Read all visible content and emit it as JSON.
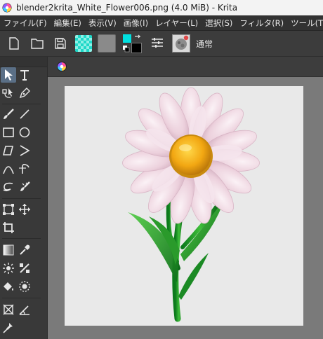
{
  "window": {
    "title": "blender2krita_White_Flower006.png (4.0 MiB)  - Krita"
  },
  "menu": [
    "ファイル(F)",
    "編集(E)",
    "表示(V)",
    "画像(I)",
    "レイヤー(L)",
    "選択(S)",
    "フィルタ(R)",
    "ツール(T)"
  ],
  "toolbar": {
    "new_icon": "new-document-icon",
    "open_icon": "open-folder-icon",
    "save_icon": "save-icon",
    "gradient_swatch_color": "#1fd8c8",
    "pattern_swatch_color": "#8a8a8a",
    "foreground_color": "#00e0e0",
    "background_color": "#000000",
    "blending_mode": "通常"
  },
  "tools": [
    [
      "select-shapes-icon",
      "text-icon"
    ],
    [
      "edit-shapes-icon",
      "calligraphy-icon"
    ],
    [
      "freehand-brush-icon",
      "line-icon"
    ],
    [
      "rectangle-icon",
      "ellipse-icon"
    ],
    [
      "polygon-icon",
      "polyline-icon"
    ],
    [
      "bezier-curve-icon",
      "freehand-path-icon"
    ],
    [
      "dynamic-brush-icon",
      "multibrush-icon"
    ],
    [
      "transform-icon",
      "move-icon"
    ],
    [
      "crop-icon",
      ""
    ],
    [
      "gradient-icon",
      "color-picker-icon"
    ],
    [
      "smart-patch-icon",
      "assistant-icon"
    ],
    [
      "fill-icon",
      "enclosed-fill-icon"
    ],
    [
      "reference-image-icon",
      "measure-icon"
    ],
    [
      "pan-icon",
      ""
    ]
  ],
  "document": {
    "tab_icon": "krita-document-icon",
    "image": "white-flower-render"
  }
}
